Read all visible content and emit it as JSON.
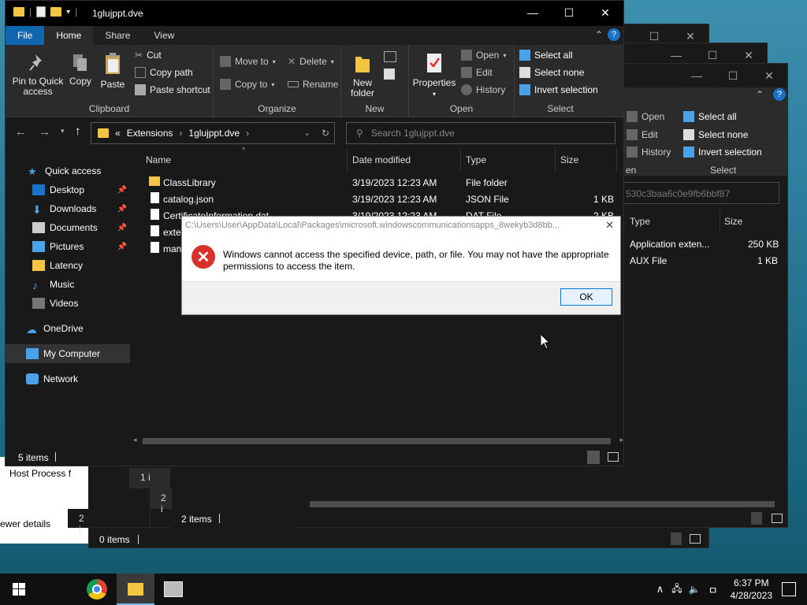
{
  "main": {
    "title": "1glujppt.dve",
    "tabs": [
      "File",
      "Home",
      "Share",
      "View"
    ],
    "ribbon": {
      "clipboard": {
        "name": "Clipboard",
        "pin": "Pin to Quick access",
        "copy": "Copy",
        "paste": "Paste",
        "cut": "Cut",
        "copy_path": "Copy path",
        "paste_shortcut": "Paste shortcut"
      },
      "organize": {
        "name": "Organize",
        "move_to": "Move to",
        "copy_to": "Copy to",
        "delete": "Delete",
        "rename": "Rename"
      },
      "new": {
        "name": "New",
        "new_folder": "New folder"
      },
      "open": {
        "name": "Open",
        "properties": "Properties",
        "open": "Open",
        "edit": "Edit",
        "history": "History"
      },
      "select": {
        "name": "Select",
        "select_all": "Select all",
        "select_none": "Select none",
        "invert": "Invert selection"
      }
    },
    "address": {
      "crumbs": [
        "Extensions",
        "1glujppt.dve"
      ],
      "prefix": "«"
    },
    "search_placeholder": "Search 1glujppt.dve",
    "nav": [
      {
        "label": "Quick access",
        "icon": "star-icon"
      },
      {
        "label": "Desktop",
        "icon": "desktop-icon",
        "pinned": true
      },
      {
        "label": "Downloads",
        "icon": "download-icon",
        "pinned": true
      },
      {
        "label": "Documents",
        "icon": "documents-icon",
        "pinned": true
      },
      {
        "label": "Pictures",
        "icon": "pictures-icon",
        "pinned": true
      },
      {
        "label": "Latency",
        "icon": "folder-icon"
      },
      {
        "label": "Music",
        "icon": "music-icon"
      },
      {
        "label": "Videos",
        "icon": "videos-icon"
      },
      {
        "label": "OneDrive",
        "icon": "cloud-icon"
      },
      {
        "label": "My Computer",
        "icon": "computer-icon",
        "selected": true
      },
      {
        "label": "Network",
        "icon": "network-icon"
      }
    ],
    "columns": [
      "Name",
      "Date modified",
      "Type",
      "Size"
    ],
    "rows": [
      {
        "name": "ClassLibrary",
        "date": "3/19/2023 12:23 AM",
        "type": "File folder",
        "size": ""
      },
      {
        "name": "catalog.json",
        "date": "3/19/2023 12:23 AM",
        "type": "JSON File",
        "size": "1 KB"
      },
      {
        "name": "CertificateInformation.dat",
        "date": "3/19/2023 12:23 AM",
        "type": "DAT File",
        "size": "2 KB"
      },
      {
        "name": "exter",
        "date": "",
        "type": "",
        "size": ""
      },
      {
        "name": "man",
        "date": "",
        "type": "",
        "size": ""
      }
    ],
    "status": "5 items"
  },
  "back1": {
    "open_group": {
      "open": "Open",
      "edit": "Edit",
      "history": "History",
      "select_all": "Select all",
      "select_none": "Select none",
      "invert": "Invert selection",
      "select": "Select",
      "en": "en"
    },
    "search_text": "530c3baa6c0e9fb6bbf87",
    "columns": [
      "Type",
      "Size"
    ],
    "rows": [
      {
        "type": "Application exten...",
        "size": "250 KB"
      },
      {
        "type": "AUX File",
        "size": "1 KB"
      }
    ],
    "status": "2 items"
  },
  "back2": {
    "status": "0 items"
  },
  "side_labels": {
    "host": "Host Process f",
    "viewer": "ewer details",
    "n1": "1 i",
    "n2": "2 i",
    "n3": "2 i"
  },
  "dialog": {
    "title": "C:\\Users\\User\\AppData\\Local\\Packages\\microsoft.windowscommunicationsapps_8wekyb3d8bb...",
    "message": "Windows cannot access the specified device, path, or file. You may not have the appropriate permissions to access the item.",
    "ok": "OK"
  },
  "taskbar": {
    "time": "6:37 PM",
    "date": "4/28/2023"
  }
}
